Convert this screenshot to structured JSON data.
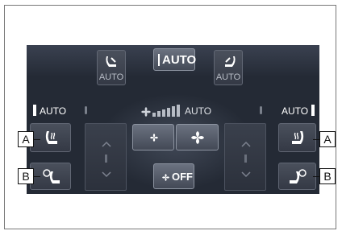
{
  "center_top": {
    "auto_label": "AUTO"
  },
  "left_vent": {
    "label": "AUTO"
  },
  "right_vent": {
    "label": "AUTO"
  },
  "left_zone": {
    "auto_label": "AUTO"
  },
  "fan": {
    "auto_label": "AUTO"
  },
  "right_zone": {
    "auto_label": "AUTO"
  },
  "off_button": {
    "label": "OFF"
  },
  "callouts": {
    "a": "A",
    "b": "B"
  }
}
